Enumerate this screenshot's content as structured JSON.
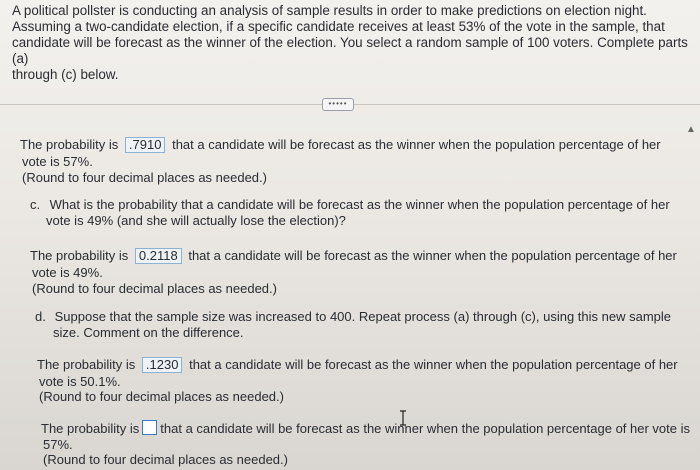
{
  "question": {
    "line1": "A political pollster is conducting an analysis of sample results in order to make predictions on election night.",
    "line2": "Assuming a two-candidate election, if a specific candidate receives at least 53% of the vote in the sample, that",
    "line3": "candidate will be forecast as the winner of the election. You select a random sample of 100 voters. Complete parts (a)",
    "line4": "through (c) below."
  },
  "more_button": "•••••",
  "part_b": {
    "prob_prefix": "The probability is",
    "prob_value": ".7910",
    "prob_suffix": "that a candidate will be forecast as the winner when the population percentage of her",
    "prob_line2": "vote is 57%.",
    "round_note": "(Round to four decimal places as needed.)"
  },
  "part_c": {
    "letter": "c.",
    "q_line1": "What is the probability that a candidate will be forecast as the winner when the population percentage of her",
    "q_line2": "vote is 49% (and she will actually lose the election)?",
    "prob_prefix": "The probability is",
    "prob_value": "0.2118",
    "prob_suffix": "that a candidate will be forecast as the winner when the population percentage of her",
    "prob_line2": "vote is 49%.",
    "round_note": "(Round to four decimal places as needed.)"
  },
  "part_d": {
    "letter": "d.",
    "q_line1": "Suppose that the sample size was increased to 400. Repeat process (a) through (c), using this new sample",
    "q_line2": "size. Comment on the difference.",
    "a_prefix": "The probability is",
    "a_value": ".1230",
    "a_suffix": "that a candidate will be forecast as the winner when the population percentage of her",
    "a_line2": "vote is 50.1%.",
    "a_round": "(Round to four decimal places as needed.)",
    "b_prefix": "The probability is",
    "b_suffix": "that a candidate will be forecast as the winner when the population percentage of her vote is",
    "b_line2": "57%.",
    "b_round": "(Round to four decimal places as needed.)"
  }
}
